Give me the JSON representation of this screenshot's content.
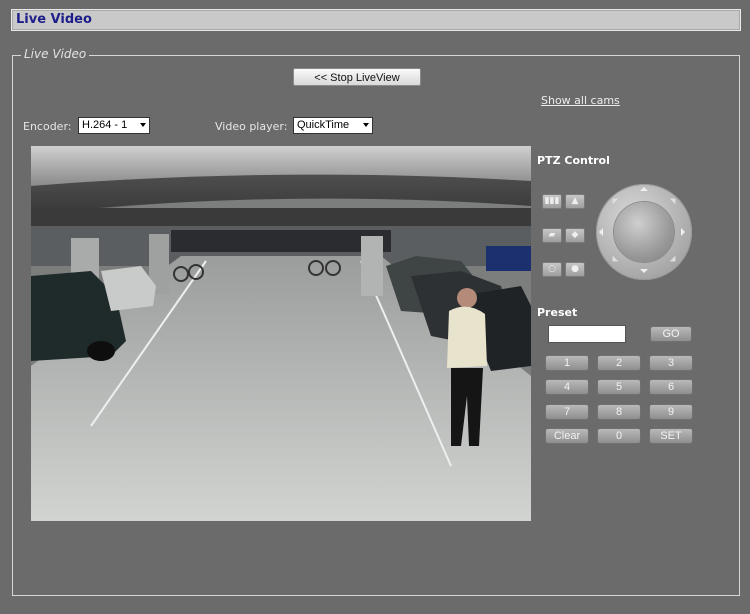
{
  "header": {
    "title": "Live Video"
  },
  "panel": {
    "legend": "Live Video"
  },
  "controls": {
    "stop_liveview": "<< Stop LiveView",
    "show_all_cams": "Show all cams",
    "encoder_label": "Encoder:",
    "encoder_value": "H.264 - 1",
    "player_label": "Video player:",
    "player_value": "QuickTime"
  },
  "ptz": {
    "title": "PTZ Control",
    "buttons": [
      "zoom-wide",
      "zoom-tele",
      "focus-near",
      "focus-far",
      "iris-close",
      "iris-open"
    ]
  },
  "preset": {
    "title": "Preset",
    "go": "GO",
    "keys": [
      "1",
      "2",
      "3",
      "4",
      "5",
      "6",
      "7",
      "8",
      "9",
      "Clear",
      "0",
      "SET"
    ]
  }
}
